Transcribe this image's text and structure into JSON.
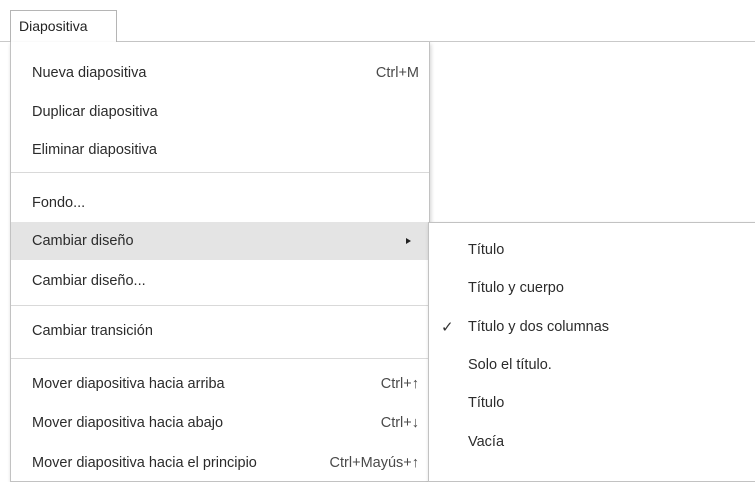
{
  "menubar": {
    "menu_label": "Diapositiva"
  },
  "menu": {
    "items": [
      {
        "label": "Nueva diapositiva",
        "shortcut": "Ctrl+M"
      },
      {
        "label": "Duplicar diapositiva",
        "shortcut": ""
      },
      {
        "label": "Eliminar diapositiva",
        "shortcut": ""
      },
      {
        "label": "Fondo...",
        "shortcut": ""
      },
      {
        "label": "Cambiar diseño",
        "shortcut": "",
        "submenu": true,
        "highlighted": true
      },
      {
        "label": "Cambiar diseño...",
        "shortcut": ""
      },
      {
        "label": "Cambiar transición",
        "shortcut": ""
      },
      {
        "label": "Mover diapositiva hacia arriba",
        "shortcut": "Ctrl+↑"
      },
      {
        "label": "Mover diapositiva hacia abajo",
        "shortcut": "Ctrl+↓"
      },
      {
        "label": "Mover diapositiva hacia el principio",
        "shortcut": "Ctrl+Mayús+↑"
      }
    ]
  },
  "submenu": {
    "check_glyph": "✓",
    "items": [
      {
        "label": "Título",
        "checked": false
      },
      {
        "label": "Título y cuerpo",
        "checked": false
      },
      {
        "label": "Título y dos columnas",
        "checked": true
      },
      {
        "label": "Solo el título.",
        "checked": false
      },
      {
        "label": "Título",
        "checked": false
      },
      {
        "label": "Vacía",
        "checked": false
      }
    ]
  },
  "colors": {
    "highlight": "#e4e4e4",
    "separator": "#d9d9d9",
    "text": "#2b2b2b"
  }
}
